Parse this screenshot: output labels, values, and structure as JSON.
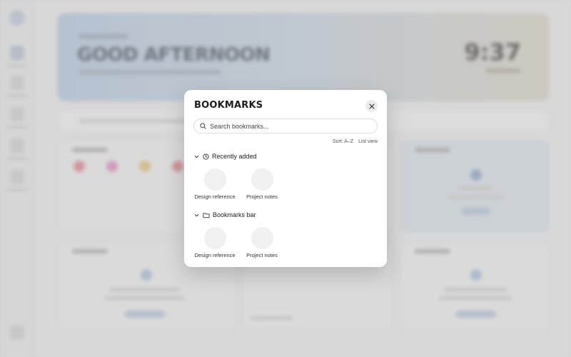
{
  "background": {
    "hero_greeting": "GOOD AFTERNOON",
    "hero_clock": "9:37"
  },
  "modal": {
    "title": "BOOKMARKS",
    "search_placeholder": "Search bookmarks...",
    "sort_label": "Sort: A–Z",
    "view_label": "List view",
    "sections": [
      {
        "label": "Recently added",
        "icon": "clock-icon",
        "items": [
          {
            "label": "Design reference"
          },
          {
            "label": "Project notes"
          }
        ]
      },
      {
        "label": "Bookmarks bar",
        "icon": "folder-icon",
        "items": [
          {
            "label": "Design reference"
          },
          {
            "label": "Project notes"
          }
        ]
      }
    ]
  },
  "colors": {
    "modal_bg": "#ffffff",
    "overlay": "#787878",
    "tile_placeholder": "#f0f0f0"
  }
}
